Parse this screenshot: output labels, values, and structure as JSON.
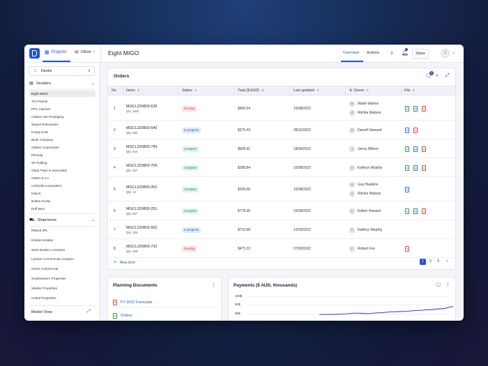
{
  "topbar": {
    "nav_projects": "Projects",
    "nav_inbox": "Inbox",
    "inbox_count": "1",
    "page_title": "Eight MIGO",
    "tab_overview": "Overview",
    "tab_actions": "Actions",
    "share_label": "Share",
    "avatar_initial": "J"
  },
  "sidebar": {
    "desks_label": "Desks",
    "vendors_label": "Vendors",
    "vendors": [
      "Eight MIGO",
      "Trio Panels",
      "PPC Vietnam",
      "Carbon Lite Packaging",
      "Wayne Enterprises",
      "Krusty Krab",
      "Bluth Company",
      "Globex Corporation",
      "Plexzap",
      "SP-holding",
      "Olivia Pope & Associates",
      "Gekko & Co",
      "Umbrella Corporation",
      "Initech",
      "Bubba Gump",
      "Duff Beer"
    ],
    "active_vendor": "Eight MIGO",
    "shipments_label": "Shipments",
    "shipments": [
      "Ritland 3PL",
      "Eclipse Estates",
      "West Modern Locations",
      "Larmier Commercial Complex",
      "Orient Commercial",
      "Southeastern Properties",
      "Skyline Properties",
      "United Properties"
    ],
    "model_view_label": "Model View"
  },
  "orders": {
    "title": "Orders",
    "notification_count": "1",
    "columns": [
      "No.",
      "Items",
      "Status",
      "Total ($ AUD)",
      "Last updated",
      "Owner",
      "File"
    ],
    "rows": [
      {
        "no": "1",
        "code": "MGCL220803-628",
        "qty": "Qty: 1102",
        "status": "Pending",
        "total": "$450.54",
        "updated": "16/08/2022",
        "owners": [
          {
            "initial": "W",
            "name": "Wade Warren"
          },
          {
            "initial": "R",
            "name": "Ritchie Watson"
          }
        ],
        "files": [
          "xls",
          "doc",
          "pdf"
        ]
      },
      {
        "no": "2",
        "code": "MGCL220803-640",
        "qty": "Qty: 692",
        "status": "In progress",
        "total": "$275.43",
        "updated": "28/10/2022",
        "owners": [
          {
            "initial": "D",
            "name": "Darrell Steward"
          }
        ],
        "files": [
          "doc",
          "pdf"
        ]
      },
      {
        "no": "3",
        "code": "MGCL220803-789",
        "qty": "Qty: 842",
        "status": "Complete",
        "total": "$928.41",
        "updated": "18/09/2022",
        "owners": [
          {
            "initial": "J",
            "name": "Jenny Wilson"
          }
        ],
        "files": [
          "xls",
          "doc",
          "pdf"
        ]
      },
      {
        "no": "4",
        "code": "MGCL220803-709",
        "qty": "Qty: 047",
        "status": "Complete",
        "total": "$398.84",
        "updated": "15/08/2022",
        "owners": [
          {
            "initial": "K",
            "name": "Kathryn Murphy"
          }
        ],
        "files": [
          "xls",
          "doc",
          "pdf"
        ]
      },
      {
        "no": "5",
        "code": "MGCL220803-352",
        "qty": "Qty: 12",
        "status": "Complete",
        "total": "$106.58",
        "updated": "15/08/2022",
        "owners": [
          {
            "initial": "G",
            "name": "Guy Hawkins"
          },
          {
            "initial": "R",
            "name": "Ritchie Watson"
          }
        ],
        "files": [
          "doc"
        ]
      },
      {
        "no": "6",
        "code": "MGCL220803-251",
        "qty": "Qty: 847",
        "status": "Complete",
        "total": "$778.35",
        "updated": "15/08/2022",
        "owners": [
          {
            "initial": "E",
            "name": "Esther Howard"
          }
        ],
        "files": [
          "xls",
          "doc",
          "pdf"
        ]
      },
      {
        "no": "7",
        "code": "MGCL220803-562",
        "qty": "Qty: 103",
        "status": "In progress",
        "total": "$710.68",
        "updated": "12/06/2022",
        "owners": [
          {
            "initial": "K",
            "name": "Kathryn Murphy"
          }
        ],
        "files": []
      },
      {
        "no": "8",
        "code": "MGCL220803-732",
        "qty": "Qty: 209",
        "status": "Pending",
        "total": "$475.22",
        "updated": "07/05/2022",
        "owners": [
          {
            "initial": "F",
            "name": "Robert Fox"
          }
        ],
        "files": [
          "pdf"
        ]
      }
    ],
    "new_item_label": "New item",
    "pages": [
      "1",
      "2",
      "3"
    ],
    "current_page": "1"
  },
  "planning": {
    "title": "Planning Documents",
    "items": [
      "FY 2022 Forecasts",
      "Orders"
    ]
  },
  "payments": {
    "title": "Payments ($ AUD, thousands)"
  },
  "chart_data": {
    "type": "line",
    "title": "Payments ($ AUD, thousands)",
    "y_ticks": [
      "100$",
      "80$",
      "60$"
    ],
    "series": [
      {
        "values": [
          58,
          58,
          59,
          61,
          60,
          62,
          64,
          65,
          67,
          69,
          71,
          76
        ]
      }
    ],
    "ylim": [
      55,
      105
    ],
    "grid": true
  },
  "colors": {
    "accent": "#2254d6",
    "chart_line": "#7a3fd8",
    "pending": "#d33c3c",
    "complete": "#238a4b"
  }
}
